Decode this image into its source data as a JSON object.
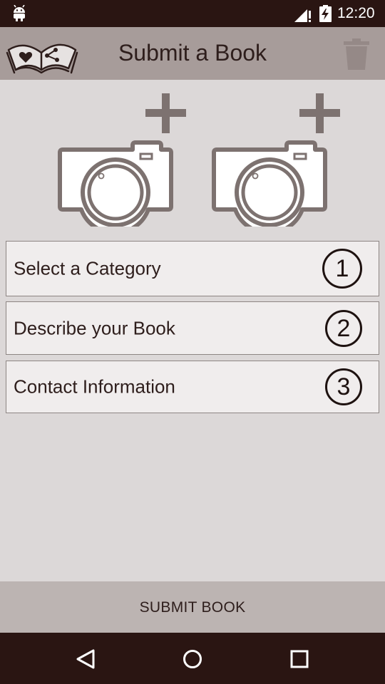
{
  "status_bar": {
    "time": "12:20",
    "icons": [
      "android-icon",
      "signal-icon",
      "battery-charging-icon"
    ]
  },
  "app_bar": {
    "title": "Submit a Book",
    "icons": [
      "book-heart-share-logo-icon",
      "trash-icon"
    ]
  },
  "photo_slots": [
    {
      "icon": "add-photo-camera-icon"
    },
    {
      "icon": "add-photo-camera-icon"
    }
  ],
  "steps": [
    {
      "label": "Select a Category",
      "number": "1"
    },
    {
      "label": "Describe your Book",
      "number": "2"
    },
    {
      "label": "Contact Information",
      "number": "3"
    }
  ],
  "submit": {
    "label": "SUBMIT BOOK"
  },
  "nav_bar": {
    "icons": [
      "back-icon",
      "home-icon",
      "recents-icon"
    ]
  },
  "colors": {
    "status_bar": "#2a1512",
    "app_bar": "#a79c9a",
    "background": "#dcd8d8",
    "step_card": "#f0eded",
    "submit_bar": "#bcb4b2",
    "icon_gray": "#7d7270"
  }
}
